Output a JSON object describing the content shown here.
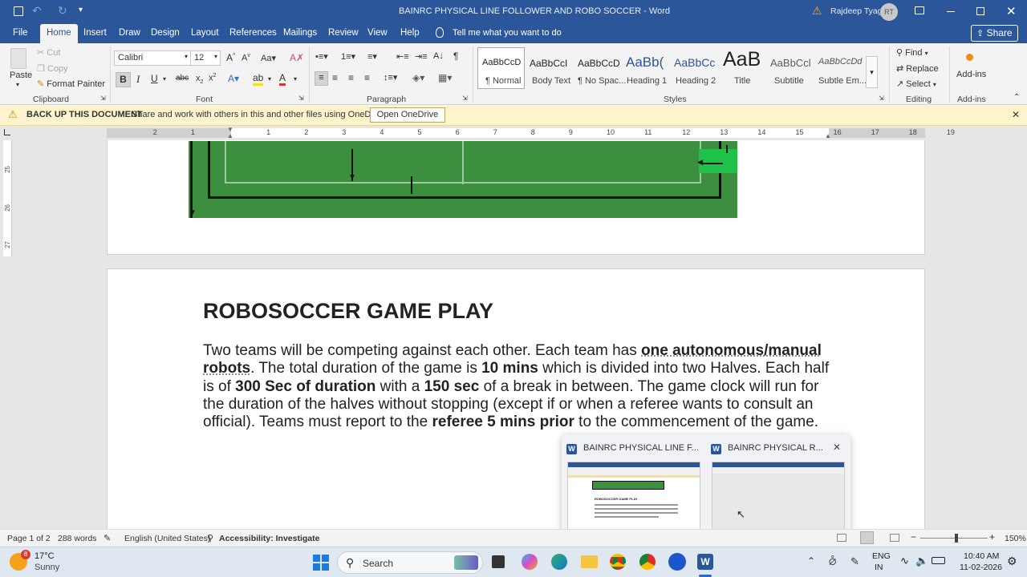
{
  "titlebar": {
    "doc_title": "BAINRC PHYSICAL LINE FOLLOWER AND ROBO SOCCER  -  Word",
    "user_name": "Rajdeep Tyagi",
    "user_initials": "RT"
  },
  "tabs": [
    "File",
    "Home",
    "Insert",
    "Draw",
    "Design",
    "Layout",
    "References",
    "Mailings",
    "Review",
    "View",
    "Help"
  ],
  "tell_me": "Tell me what you want to do",
  "share_label": "Share",
  "clipboard": {
    "paste": "Paste",
    "cut": "Cut",
    "copy": "Copy",
    "format_painter": "Format Painter",
    "group": "Clipboard"
  },
  "font": {
    "name": "Calibri",
    "size": "12",
    "group": "Font"
  },
  "paragraph": {
    "group": "Paragraph"
  },
  "styles": {
    "group": "Styles",
    "items": [
      {
        "preview": "AaBbCcD",
        "name": "¶ Normal"
      },
      {
        "preview": "AaBbCcI",
        "name": "Body Text"
      },
      {
        "preview": "AaBbCcD",
        "name": "¶ No Spac..."
      },
      {
        "preview": "AaBb(",
        "name": "Heading 1"
      },
      {
        "preview": "AaBbCc",
        "name": "Heading 2"
      },
      {
        "preview": "AaB",
        "name": "Title"
      },
      {
        "preview": "AaBbCcl",
        "name": "Subtitle"
      },
      {
        "preview": "AaBbCcDd",
        "name": "Subtle Em..."
      }
    ]
  },
  "editing": {
    "find": "Find",
    "replace": "Replace",
    "select": "Select",
    "group": "Editing"
  },
  "addins": {
    "label": "Add-ins",
    "group": "Add-ins"
  },
  "message_bar": {
    "title": "BACK UP THIS DOCUMENT",
    "text": "Share and work with others in this and other files using OneDrive.",
    "button": "Open OneDrive"
  },
  "ruler_numbers": [
    "2",
    "1",
    "1",
    "2",
    "3",
    "4",
    "5",
    "6",
    "7",
    "8",
    "9",
    "10",
    "11",
    "12",
    "13",
    "14",
    "15",
    "16",
    "17",
    "18",
    "19"
  ],
  "vruler_numbers": [
    "25",
    "26",
    "27"
  ],
  "document": {
    "heading": "ROBOSOCCER GAME PLAY",
    "p1": "Two teams will be competing against each other. Each team has ",
    "b1": "one autonomous/manual robots",
    "p2": ". The total duration of the game is ",
    "b2": "10 mins",
    "p3": " which is divided into two Halves. Each half is of ",
    "b3": "300 Sec of duration",
    "p4": " with a ",
    "b4": "150 sec",
    "p5": " of a break in between. The game clock will run for the duration of the halves without stopping (except if or when a referee wants to consult an official). Teams must report to the ",
    "b5": "referee 5 mins prior",
    "p6": " to the commencement of the game."
  },
  "preview": {
    "window1": "BAINRC PHYSICAL LINE F...",
    "window2": "BAINRC PHYSICAL R...",
    "thumb_heading": "ROBOSOCCER GAME PLAY"
  },
  "status": {
    "page": "Page 1 of 2",
    "words": "288 words",
    "language": "English (United States)",
    "accessibility": "Accessibility: Investigate",
    "zoom": "150%"
  },
  "taskbar": {
    "temp": "17°C",
    "weather": "Sunny",
    "weather_badge": "8",
    "search": "Search",
    "lang1": "ENG",
    "lang2": "IN",
    "time": "10:40 AM",
    "date": "11-02-2026"
  },
  "colors": {
    "word_blue": "#2b579a",
    "field_green": "#3c8f3f",
    "message_bar": "#fff4ce"
  }
}
